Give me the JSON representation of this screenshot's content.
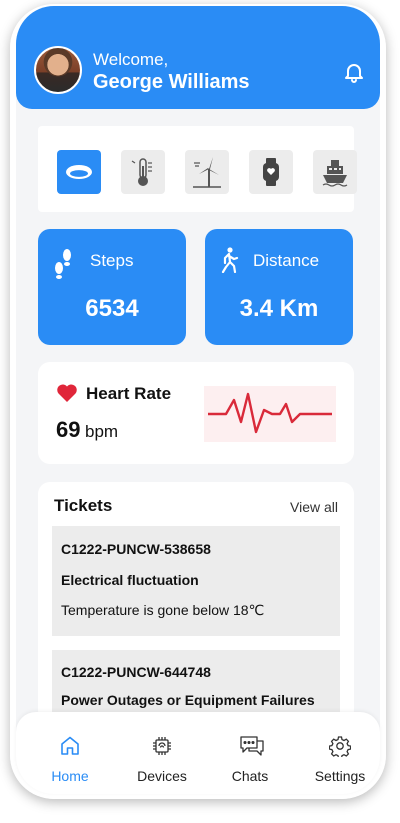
{
  "header": {
    "greeting": "Welcome,",
    "user_name": "George Williams"
  },
  "devices": {
    "items": [
      {
        "icon": "ring-icon",
        "active": true
      },
      {
        "icon": "thermometer-icon",
        "active": false
      },
      {
        "icon": "wind-turbine-icon",
        "active": false
      },
      {
        "icon": "smartwatch-icon",
        "active": false
      },
      {
        "icon": "ship-icon",
        "active": false
      }
    ]
  },
  "stats": {
    "steps": {
      "label": "Steps",
      "value": "6534"
    },
    "distance": {
      "label": "Distance",
      "value": "3.4 Km"
    }
  },
  "heart_rate": {
    "title": "Heart Rate",
    "value": "69",
    "unit": "bpm"
  },
  "tickets": {
    "title": "Tickets",
    "view_all": "View all",
    "items": [
      {
        "id": "C1222-PUNCW-538658",
        "type": "Electrical fluctuation",
        "description": "Temperature is gone below 18℃"
      },
      {
        "id": "C1222-PUNCW-644748",
        "type": "Power Outages or Equipment Failures",
        "description": ""
      }
    ]
  },
  "tabbar": {
    "tabs": [
      {
        "label": "Home",
        "icon": "home-icon",
        "active": true
      },
      {
        "label": "Devices",
        "icon": "chip-icon",
        "active": false
      },
      {
        "label": "Chats",
        "icon": "chat-icon",
        "active": false
      },
      {
        "label": "Settings",
        "icon": "gear-icon",
        "active": false
      }
    ]
  },
  "colors": {
    "accent": "#2a8cf5",
    "heart": "#e0263a",
    "ecg_line": "#d92a3a",
    "ecg_bg": "#fdeff0"
  }
}
